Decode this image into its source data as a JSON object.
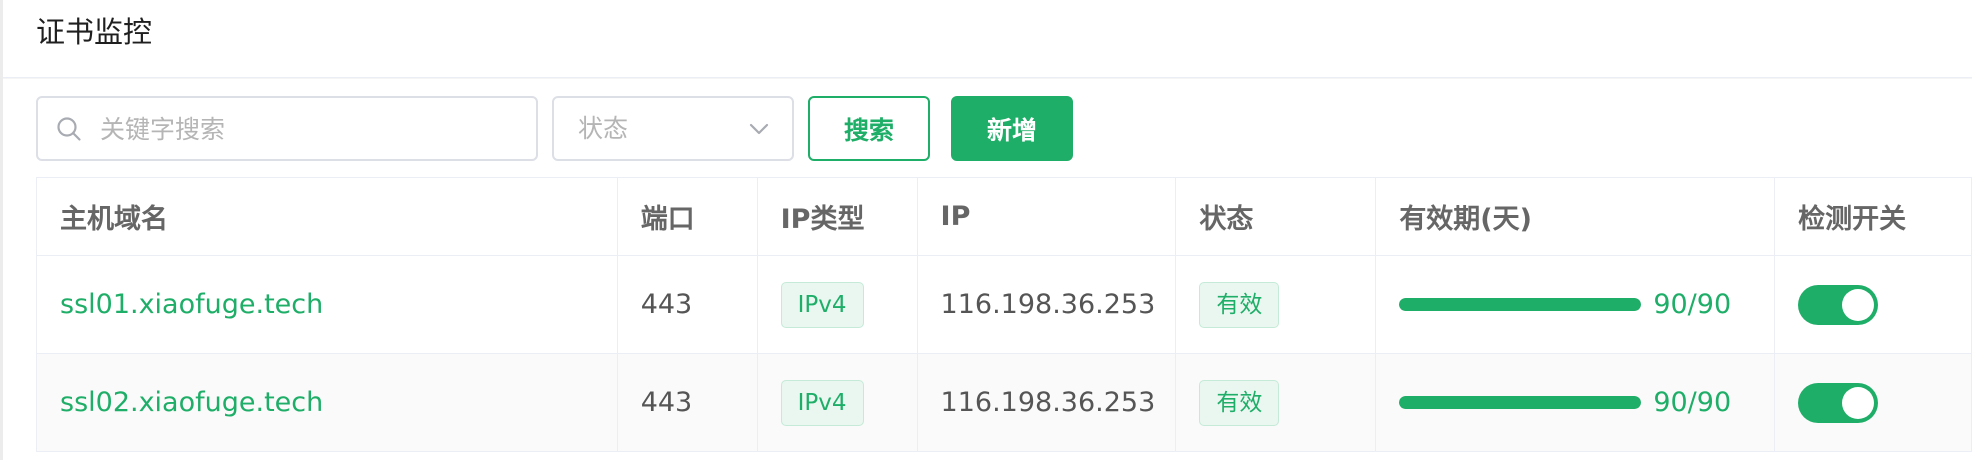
{
  "page": {
    "title": "证书监控"
  },
  "toolbar": {
    "search_placeholder": "关键字搜索",
    "status_placeholder": "状态",
    "search_button": "搜索",
    "add_button": "新增"
  },
  "table": {
    "columns": [
      "主机域名",
      "端口",
      "IP类型",
      "IP",
      "状态",
      "有效期(天)",
      "检测开关"
    ],
    "rows": [
      {
        "host": "ssl01.xiaofuge.tech",
        "port": "443",
        "ip_type": "IPv4",
        "ip": "116.198.36.253",
        "status": "有效",
        "validity_text": "90/90",
        "validity_ratio": 1.0,
        "check_enabled": true
      },
      {
        "host": "ssl02.xiaofuge.tech",
        "port": "443",
        "ip_type": "IPv4",
        "ip": "116.198.36.253",
        "status": "有效",
        "validity_text": "90/90",
        "validity_ratio": 1.0,
        "check_enabled": true
      }
    ]
  },
  "colors": {
    "accent": "#1fae68",
    "tag_bg": "#e9f7f0",
    "border": "#dcdfe6"
  }
}
